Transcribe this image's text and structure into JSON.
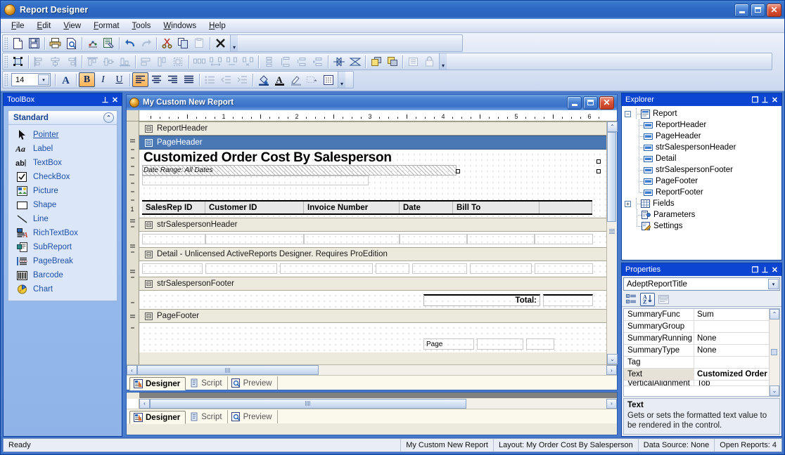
{
  "window": {
    "title": "Report Designer",
    "icon": "app-icon",
    "buttons": {
      "minimize": "_",
      "maximize": "□",
      "close": "✕"
    }
  },
  "menu": {
    "items": [
      {
        "label": "File",
        "accel": "F"
      },
      {
        "label": "Edit",
        "accel": "E"
      },
      {
        "label": "View",
        "accel": "V"
      },
      {
        "label": "Format",
        "accel": "F"
      },
      {
        "label": "Tools",
        "accel": "T"
      },
      {
        "label": "Windows",
        "accel": "W"
      },
      {
        "label": "Help",
        "accel": "H"
      }
    ]
  },
  "toolbars": {
    "standard": {
      "overflow": "▾",
      "buttons": [
        {
          "name": "new-icon",
          "enabled": true
        },
        {
          "name": "save-icon",
          "enabled": true
        },
        {
          "name": "print-icon",
          "enabled": true
        },
        {
          "name": "print-preview-icon",
          "enabled": true
        },
        {
          "name": "data-source-icon",
          "enabled": true
        },
        {
          "name": "report-settings-icon",
          "enabled": true
        },
        {
          "name": "undo-icon",
          "enabled": true
        },
        {
          "name": "redo-icon",
          "enabled": false
        },
        {
          "name": "cut-icon",
          "enabled": true
        },
        {
          "name": "copy-icon",
          "enabled": true
        },
        {
          "name": "paste-icon",
          "enabled": false
        },
        {
          "name": "delete-icon",
          "enabled": true
        }
      ]
    },
    "layout": {
      "overflow": "▾",
      "buttons": [
        {
          "name": "select-control-icon",
          "enabled": true
        },
        {
          "name": "align-lefts-icon",
          "enabled": false
        },
        {
          "name": "align-centers-icon",
          "enabled": false
        },
        {
          "name": "align-rights-icon",
          "enabled": false
        },
        {
          "name": "align-tops-icon",
          "enabled": false
        },
        {
          "name": "align-middles-icon",
          "enabled": false
        },
        {
          "name": "align-bottoms-icon",
          "enabled": false
        },
        {
          "name": "size-width-icon",
          "enabled": false
        },
        {
          "name": "size-height-icon",
          "enabled": false
        },
        {
          "name": "size-both-icon",
          "enabled": false
        },
        {
          "name": "space-horizontal-equal-icon",
          "enabled": false
        },
        {
          "name": "space-horizontal-increase-icon",
          "enabled": false
        },
        {
          "name": "space-horizontal-decrease-icon",
          "enabled": false
        },
        {
          "name": "space-horizontal-remove-icon",
          "enabled": false
        },
        {
          "name": "space-vertical-equal-icon",
          "enabled": false
        },
        {
          "name": "space-vertical-increase-icon",
          "enabled": false
        },
        {
          "name": "space-vertical-decrease-icon",
          "enabled": false
        },
        {
          "name": "space-vertical-remove-icon",
          "enabled": false
        },
        {
          "name": "center-horizontally-icon",
          "enabled": true
        },
        {
          "name": "center-vertically-icon",
          "enabled": true
        },
        {
          "name": "bring-to-front-icon",
          "enabled": true
        },
        {
          "name": "send-to-back-icon",
          "enabled": true
        },
        {
          "name": "order-icon",
          "enabled": false
        },
        {
          "name": "lock-controls-icon",
          "enabled": false
        }
      ]
    },
    "format": {
      "overflow": "▾",
      "font_size": "14",
      "font_size_dropdown": "▾",
      "buttons": [
        {
          "name": "font-icon",
          "enabled": true,
          "active": false
        },
        {
          "name": "bold-icon",
          "enabled": true,
          "active": true,
          "glyph": "B"
        },
        {
          "name": "italic-icon",
          "enabled": true,
          "active": false,
          "glyph": "I"
        },
        {
          "name": "underline-icon",
          "enabled": true,
          "active": false,
          "glyph": "U"
        },
        {
          "name": "align-left-icon",
          "enabled": true,
          "active": true
        },
        {
          "name": "align-center-icon",
          "enabled": true,
          "active": false
        },
        {
          "name": "align-right-icon",
          "enabled": true,
          "active": false
        },
        {
          "name": "align-justify-icon",
          "enabled": true,
          "active": false
        },
        {
          "name": "bullet-list-icon",
          "enabled": false,
          "active": false
        },
        {
          "name": "outdent-icon",
          "enabled": false,
          "active": false
        },
        {
          "name": "indent-icon",
          "enabled": false,
          "active": false
        },
        {
          "name": "fill-color-icon",
          "enabled": true,
          "active": false
        },
        {
          "name": "font-color-icon",
          "enabled": true,
          "active": false
        },
        {
          "name": "line-color-icon",
          "enabled": true,
          "active": false
        },
        {
          "name": "border-style-icon",
          "enabled": false,
          "active": false
        },
        {
          "name": "grid-icon",
          "enabled": true,
          "active": false
        }
      ]
    }
  },
  "toolbox": {
    "title": "ToolBox",
    "pin": "⊥",
    "close": "✕",
    "group": {
      "label": "Standard",
      "collapse": "⌃"
    },
    "items": [
      {
        "label": "Pointer",
        "icon": "pointer-icon",
        "selected": true
      },
      {
        "label": "Label",
        "icon": "label-icon",
        "selected": false
      },
      {
        "label": "TextBox",
        "icon": "textbox-icon",
        "selected": false
      },
      {
        "label": "CheckBox",
        "icon": "checkbox-icon",
        "selected": false
      },
      {
        "label": "Picture",
        "icon": "picture-icon",
        "selected": false
      },
      {
        "label": "Shape",
        "icon": "shape-icon",
        "selected": false
      },
      {
        "label": "Line",
        "icon": "line-icon",
        "selected": false
      },
      {
        "label": "RichTextBox",
        "icon": "richtextbox-icon",
        "selected": false
      },
      {
        "label": "SubReport",
        "icon": "subreport-icon",
        "selected": false
      },
      {
        "label": "PageBreak",
        "icon": "pagebreak-icon",
        "selected": false
      },
      {
        "label": "Barcode",
        "icon": "barcode-icon",
        "selected": false
      },
      {
        "label": "Chart",
        "icon": "chart-icon",
        "selected": false
      }
    ]
  },
  "designer": {
    "window_title": "My Custom New Report",
    "buttons": {
      "minimize": "_",
      "maximize": "□",
      "close": "✕"
    },
    "ruler": {
      "marks": [
        "1",
        "2",
        "3",
        "4",
        "5",
        "6"
      ]
    },
    "vruler_mark": "1",
    "report_title": "Customized Order Cost By Salesperson",
    "report_subtitle": "Date Range: All Dates",
    "column_headers": [
      "SalesRep ID",
      "Customer ID",
      "Invoice Number",
      "Date",
      "Bill To"
    ],
    "total_label": "Total:",
    "page_footer_text": "Page",
    "bands": [
      {
        "label": "ReportHeader",
        "selected": false,
        "collapse": "⊟"
      },
      {
        "label": "PageHeader",
        "selected": true,
        "collapse": "⊟"
      },
      {
        "label": "strSalespersonHeader",
        "selected": false,
        "collapse": "⊟"
      },
      {
        "label": "Detail  -  Unlicensed ActiveReports Designer. Requires ProEdition",
        "selected": false,
        "collapse": "⊟"
      },
      {
        "label": "strSalespersonFooter",
        "selected": false,
        "collapse": "⊟"
      },
      {
        "label": "PageFooter",
        "selected": false,
        "collapse": "⊟"
      }
    ],
    "tabs": [
      {
        "label": "Designer",
        "icon": "designer-icon",
        "active": true
      },
      {
        "label": "Script",
        "icon": "script-icon",
        "active": false
      },
      {
        "label": "Preview",
        "icon": "preview-icon",
        "active": false
      }
    ],
    "scroll_left": "‹",
    "scroll_right": "›",
    "scroll_up": "⌃",
    "scroll_down": "⌄"
  },
  "background_window": {
    "tabs": [
      {
        "label": "Designer",
        "icon": "designer-icon",
        "active": true
      },
      {
        "label": "Script",
        "icon": "script-icon",
        "active": false
      },
      {
        "label": "Preview",
        "icon": "preview-icon",
        "active": false
      }
    ],
    "scroll_left": "‹",
    "scroll_right": "›"
  },
  "explorer": {
    "title": "Explorer",
    "restore": "❐",
    "pin": "⊥",
    "close": "✕",
    "root": {
      "label": "Report",
      "icon": "report-icon",
      "expander": "−"
    },
    "sections": [
      {
        "label": "ReportHeader",
        "icon": "band-icon"
      },
      {
        "label": "PageHeader",
        "icon": "band-icon"
      },
      {
        "label": "strSalespersonHeader",
        "icon": "band-icon"
      },
      {
        "label": "Detail",
        "icon": "band-icon"
      },
      {
        "label": "strSalespersonFooter",
        "icon": "band-icon"
      },
      {
        "label": "PageFooter",
        "icon": "band-icon"
      },
      {
        "label": "ReportFooter",
        "icon": "band-icon"
      }
    ],
    "extras": [
      {
        "label": "Fields",
        "icon": "fields-icon",
        "expander": "+"
      },
      {
        "label": "Parameters",
        "icon": "parameters-icon",
        "expander": ""
      },
      {
        "label": "Settings",
        "icon": "settings-icon",
        "expander": ""
      }
    ]
  },
  "properties": {
    "title": "Properties",
    "restore": "❐",
    "pin": "⊥",
    "close": "✕",
    "selected_object": "AdeptReportTitle",
    "dropdown": "▾",
    "toolbar": [
      {
        "name": "categorized-view-icon",
        "active": false
      },
      {
        "name": "alphabetical-sort-icon",
        "active": true
      },
      {
        "name": "property-pages-icon",
        "active": false,
        "enabled": false
      }
    ],
    "rows": [
      {
        "key": "SummaryFunc",
        "value": "Sum",
        "selected": false
      },
      {
        "key": "SummaryGroup",
        "value": "",
        "selected": false
      },
      {
        "key": "SummaryRunning",
        "value": "None",
        "selected": false
      },
      {
        "key": "SummaryType",
        "value": "None",
        "selected": false
      },
      {
        "key": "Tag",
        "value": "",
        "selected": false
      },
      {
        "key": "Text",
        "value": "Customized Order",
        "selected": true
      },
      {
        "key": "VerticalAlignment",
        "value": "Top",
        "selected": false
      }
    ],
    "description": {
      "title": "Text",
      "body": "Gets or sets the formatted text value to be rendered in the control."
    },
    "scroll_up": "⌃",
    "scroll_down": "⌄"
  },
  "statusbar": {
    "message": "Ready",
    "cells": [
      "My Custom New Report",
      "Layout: My Order Cost By Salesperson",
      "Data Source: None",
      "Open Reports: 4"
    ]
  },
  "colors": {
    "title_blue": "#2f6ac4",
    "panel_header_blue": "#0b45d2",
    "selected_band": "#4a78b4",
    "active_toolbar_button": "#ffb054",
    "canvas": "#ece9dd"
  }
}
